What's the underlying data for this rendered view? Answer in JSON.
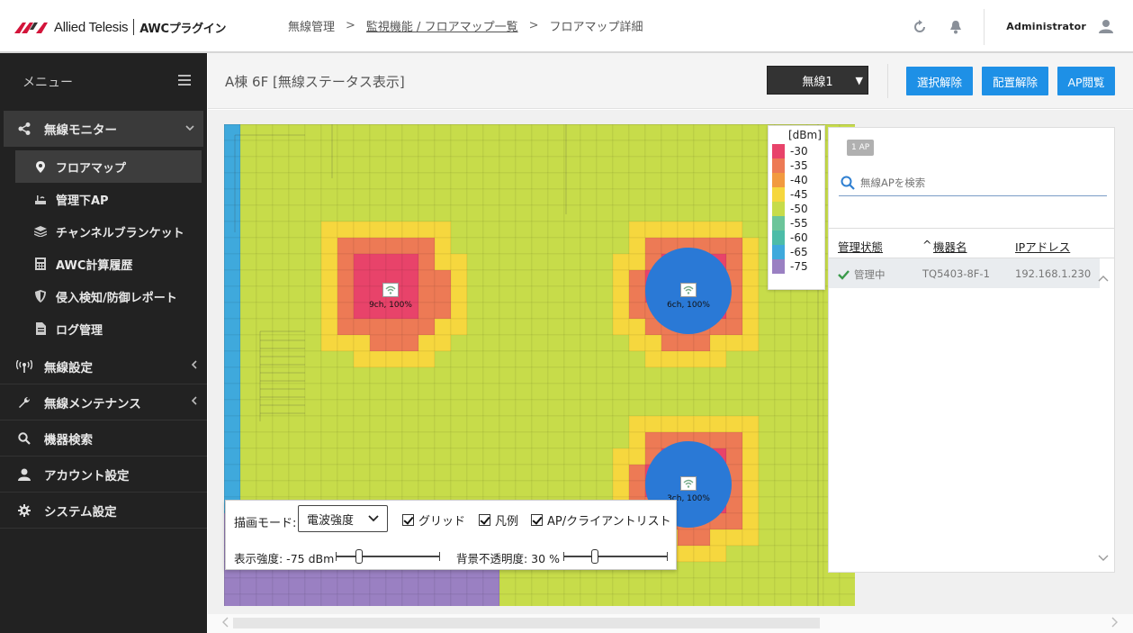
{
  "header": {
    "brand": "Allied Telesis",
    "product": "AWCプラグイン",
    "breadcrumb": [
      "無線管理",
      "監視機能 / フロアマップ一覧",
      "フロアマップ詳細"
    ],
    "breadcrumb_sep": ">",
    "user": "Administrator"
  },
  "sidebar": {
    "menu_label": "メニュー",
    "items": [
      {
        "label": "無線モニター",
        "icon": "share-icon",
        "open": true,
        "chevron": "down",
        "children": [
          {
            "label": "フロアマップ",
            "icon": "map-pin-icon",
            "active": true
          },
          {
            "label": "管理下AP",
            "icon": "access-point-icon"
          },
          {
            "label": "チャンネルブランケット",
            "icon": "layers-icon"
          },
          {
            "label": "AWC計算履歴",
            "icon": "calculator-icon"
          },
          {
            "label": "侵入検知/防御レポート",
            "icon": "shield-icon"
          },
          {
            "label": "ログ管理",
            "icon": "document-icon"
          }
        ]
      },
      {
        "label": "無線設定",
        "icon": "antenna-icon",
        "chevron": "left"
      },
      {
        "label": "無線メンテナンス",
        "icon": "wrench-icon",
        "chevron": "left"
      },
      {
        "label": "機器検索",
        "icon": "search-icon"
      },
      {
        "label": "アカウント設定",
        "icon": "user-icon"
      },
      {
        "label": "システム設定",
        "icon": "gear-icon"
      }
    ]
  },
  "content": {
    "title": "A棟 6F [無線ステータス表示]",
    "radio_select": "無線1",
    "buttons": {
      "deselect": "選択解除",
      "unplace": "配置解除",
      "ap_view": "AP閲覧"
    }
  },
  "map": {
    "legend_unit": "[dBm]",
    "legend": [
      {
        "label": "-30",
        "color": "#e8436a"
      },
      {
        "label": "-35",
        "color": "#ed7a55"
      },
      {
        "label": "-40",
        "color": "#f29a3f"
      },
      {
        "label": "-45",
        "color": "#f6d73e"
      },
      {
        "label": "-50",
        "color": "#c7dc4a"
      },
      {
        "label": "-55",
        "color": "#6cc59a"
      },
      {
        "label": "-60",
        "color": "#4cbca8"
      },
      {
        "label": "-65",
        "color": "#3fa9dc"
      },
      {
        "label": "-75",
        "color": "#9a80c2"
      }
    ],
    "aps": [
      {
        "label": "9ch, 100%",
        "icon": "wifi-icon"
      },
      {
        "label": "6ch, 100%",
        "icon": "wifi-icon"
      },
      {
        "label": "3ch, 100%",
        "icon": "wifi-icon"
      }
    ]
  },
  "controls": {
    "mode_label": "描画モード:",
    "mode_value": "電波強度",
    "checks": [
      "グリッド",
      "凡例",
      "AP/クライアントリスト"
    ],
    "strength_label": "表示強度: -75 dBm",
    "opacity_label": "背景不透明度: 30 %",
    "strength_level": 0.22,
    "opacity_level": 0.3
  },
  "ap_panel": {
    "count": "1 AP",
    "search_placeholder": "無線APを検索",
    "columns": [
      "管理状態",
      "機器名",
      "IPアドレス"
    ],
    "sort_indicator": "^",
    "rows": [
      {
        "status": "管理中",
        "name": "TQ5403-8F-1",
        "ip": "192.168.1.230"
      }
    ]
  }
}
